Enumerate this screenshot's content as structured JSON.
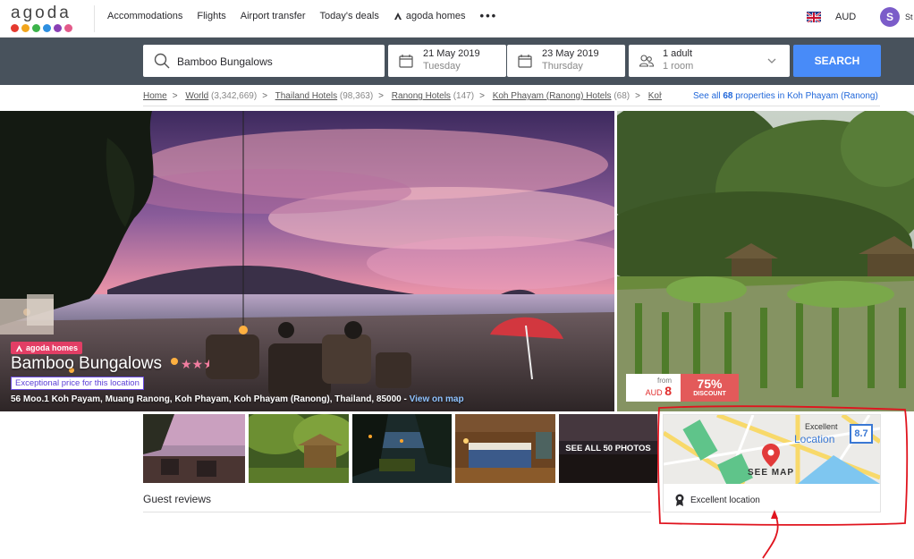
{
  "nav": {
    "logo_text": "agoda",
    "logo_colors": [
      "#e53a2f",
      "#f2a51c",
      "#3cb34a",
      "#2d8fe0",
      "#8a3fb4",
      "#e35a8a"
    ],
    "links": [
      "Accommodations",
      "Flights",
      "Airport transfer",
      "Today's deals"
    ],
    "homes_link": "agoda homes",
    "more": "•••",
    "currency": "AUD",
    "avatar_initial": "S",
    "avatar_name": "St"
  },
  "search": {
    "destination": "Bamboo Bungalows",
    "checkin_date": "21 May 2019",
    "checkin_day": "Tuesday",
    "checkout_date": "23 May 2019",
    "checkout_day": "Thursday",
    "guests": "1 adult",
    "rooms": "1 room",
    "button": "SEARCH"
  },
  "breadcrumb": {
    "items": [
      {
        "label": "Home",
        "count": ""
      },
      {
        "label": "World",
        "count": "(3,342,669)"
      },
      {
        "label": "Thailand Hotels",
        "count": "(98,363)"
      },
      {
        "label": "Ranong Hotels",
        "count": "(147)"
      },
      {
        "label": "Koh Phayam (Ranong) Hotels",
        "count": "(68)"
      },
      {
        "label": "Koh Ph",
        "count": ""
      }
    ],
    "see_all_prefix": "See all",
    "see_all_count": "68",
    "see_all_suffix": "properties in Koh Phayam (Ranong)"
  },
  "hotel": {
    "badge": "agoda homes",
    "name": "Bamboo Bungalows",
    "stars": "★★",
    "half_star": "★",
    "exceptional_price": "Exceptional price for this location",
    "address": "56 Moo.1 Koh Payam, Muang Ranong, Koh Phayam, Koh Phayam (Ranong), Thailand, 85000 -",
    "view_on_map": "View on map",
    "star_rating": 2.5
  },
  "price": {
    "from": "from",
    "currency": "AUD",
    "amount": "8",
    "discount_pct": "75%",
    "discount_label": "DISCOUNT"
  },
  "photos": {
    "see_all": "SEE ALL 50 PHOTOS"
  },
  "map_card": {
    "excellent": "Excellent",
    "location": "Location",
    "score": "8.7",
    "see_map": "SEE MAP",
    "excellent_location": "Excellent location"
  },
  "reviews": {
    "title": "Guest reviews"
  },
  "colors": {
    "accent_blue": "#488bf8",
    "search_bar_bg": "#48525c",
    "homes_pink": "#e23e65",
    "discount_red": "#e35a5a",
    "annotation_red": "#e0141e"
  }
}
